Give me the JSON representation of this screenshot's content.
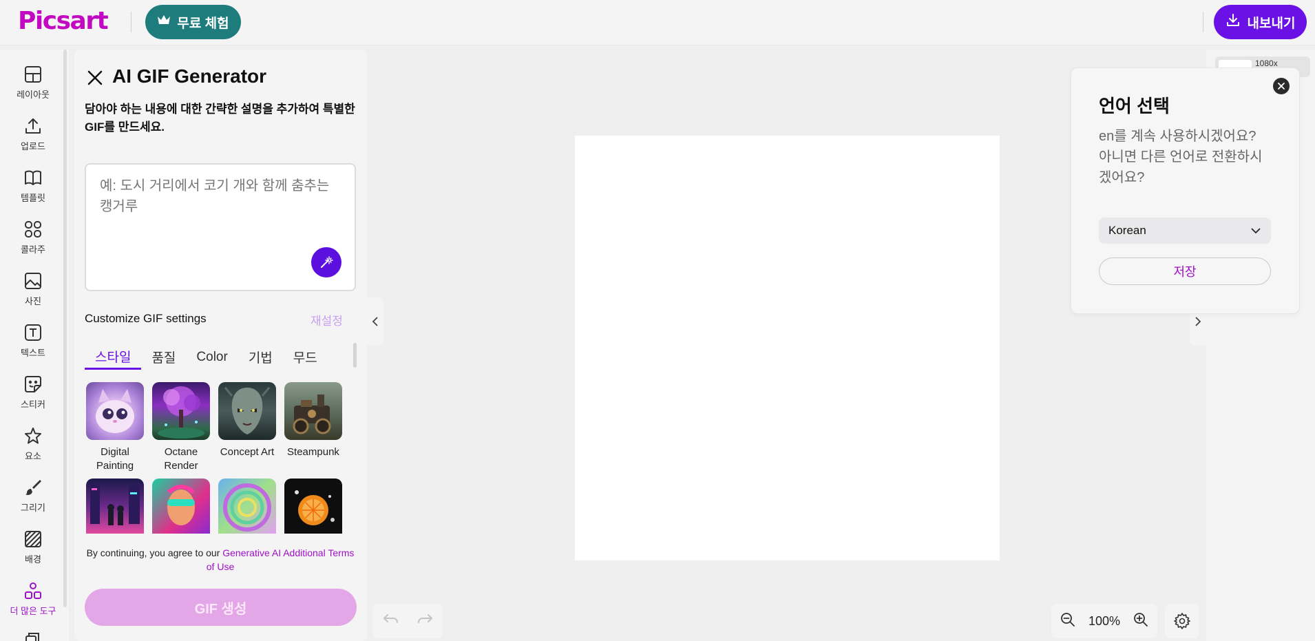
{
  "header": {
    "logo": "Picsart",
    "trial_label": "무료 체험",
    "export_label": "내보내기"
  },
  "tools": [
    {
      "label": "레이아웃",
      "icon": "layout-icon"
    },
    {
      "label": "업로드",
      "icon": "upload-icon"
    },
    {
      "label": "템플릿",
      "icon": "template-icon"
    },
    {
      "label": "콜라주",
      "icon": "collage-icon"
    },
    {
      "label": "사진",
      "icon": "photo-icon"
    },
    {
      "label": "텍스트",
      "icon": "text-icon"
    },
    {
      "label": "스티커",
      "icon": "sticker-icon"
    },
    {
      "label": "요소",
      "icon": "star-icon"
    },
    {
      "label": "그리기",
      "icon": "brush-icon"
    },
    {
      "label": "배경",
      "icon": "background-icon"
    },
    {
      "label": "더 많은 도구",
      "icon": "more-tools-icon"
    }
  ],
  "panel": {
    "title": "AI GIF Generator",
    "description": "담아야 하는 내용에 대한 간략한 설명을 추가하여 특별한 GIF를 만드세요.",
    "prompt_placeholder": "예: 도시 거리에서 코기 개와 함께 춤추는 캥거루",
    "customize_label": "Customize GIF settings",
    "reset_label": "재설정",
    "tabs": [
      "스타일",
      "품질",
      "Color",
      "기법",
      "무드"
    ],
    "active_tab": "스타일",
    "styles": [
      {
        "name": "Digital Painting"
      },
      {
        "name": "Octane Render"
      },
      {
        "name": "Concept Art"
      },
      {
        "name": "Steampunk"
      },
      {
        "name": ""
      },
      {
        "name": ""
      },
      {
        "name": ""
      },
      {
        "name": ""
      }
    ],
    "terms_prefix": "By continuing, you agree to our ",
    "terms_link": "Generative AI Additional Terms of Use",
    "generate_label": "GIF 생성"
  },
  "canvas": {
    "zoom": "100%",
    "layer_size": "1080x"
  },
  "language_popup": {
    "title": "언어 선택",
    "message": "en를 계속 사용하시겠어요? 아니면 다른 언어로 전환하시겠어요?",
    "selected_language": "Korean",
    "save_label": "저장"
  },
  "colors": {
    "brand": "#c209c1",
    "trial": "#1e7c7c",
    "export": "#6a11e6",
    "generate_disabled": "#e3a6e6"
  }
}
